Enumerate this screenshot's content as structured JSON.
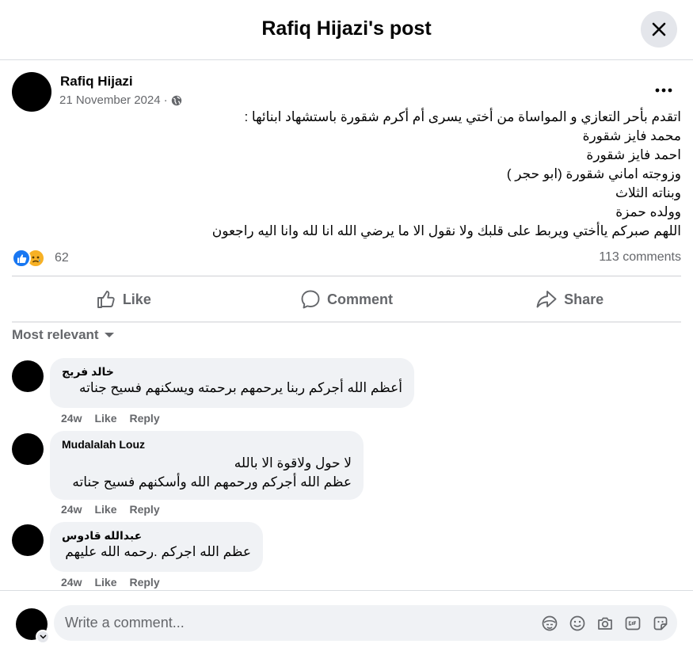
{
  "dialog": {
    "title": "Rafiq Hijazi's post"
  },
  "post": {
    "author": "Rafiq Hijazi",
    "date": "21 November 2024",
    "meta_separator": "·",
    "lines": [
      "اتقدم بأحر التعازي و المواساة من أختي يسرى أم أكرم شقورة باستشهاد ابنائها :",
      "محمد فايز شقورة",
      "احمد فايز شقورة",
      "وزوجته اماني شقورة (ابو حجر )",
      "وبناته الثلاث",
      "وولده حمزة",
      "اللهم صبركم ياأختي ويربط على قلبك ولا نقول الا ما يرضي الله انا لله وانا اليه راجعون"
    ],
    "reaction_count": "62",
    "comment_count": "113 comments"
  },
  "actions": {
    "like": "Like",
    "comment": "Comment",
    "share": "Share"
  },
  "sort": {
    "label": "Most relevant"
  },
  "comments": [
    {
      "author": "خالد فريج",
      "lines": [
        "أعظم الله أجركم ربنا يرحمهم برحمته ويسكنهم فسيح جناته"
      ],
      "time": "24w",
      "like": "Like",
      "reply": "Reply"
    },
    {
      "author": "Mudalalah Louz",
      "lines": [
        "لا حول ولاقوة الا بالله",
        "عظم الله أجركم ورحمهم الله وأسكنهم فسيح جناته"
      ],
      "time": "24w",
      "like": "Like",
      "reply": "Reply"
    },
    {
      "author": "عبدالله قادوس",
      "lines": [
        "عظم الله اجركم .رحمه الله عليهم"
      ],
      "time": "24w",
      "like": "Like",
      "reply": "Reply"
    }
  ],
  "composer": {
    "placeholder": "Write a comment..."
  },
  "icons": {
    "close": "close-icon",
    "more": "more-dots-icon",
    "globe": "globe-icon",
    "like_reaction": "like-reaction-icon",
    "sad_reaction": "sad-reaction-icon",
    "thumb": "thumbs-up-icon",
    "comment": "comment-icon",
    "share": "share-icon",
    "caret": "caret-down-icon",
    "avatar_sticker": "avatar-sticker-icon",
    "emoji": "emoji-icon",
    "camera": "camera-icon",
    "gif": "gif-icon",
    "sticker": "sticker-icon"
  },
  "colors": {
    "accent": "#1877f2",
    "secondary_text": "#65676b",
    "bubble": "#f0f2f5",
    "sad": "#f7b125"
  }
}
